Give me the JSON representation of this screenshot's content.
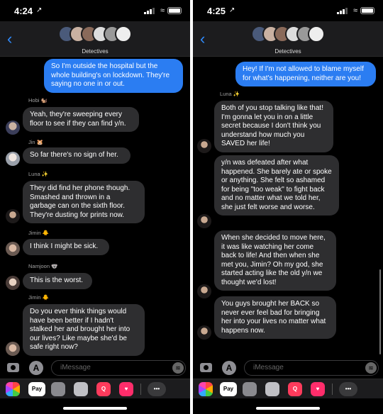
{
  "left": {
    "status": {
      "time": "4:24"
    },
    "header": {
      "group_name": "Detectives"
    },
    "messages": {
      "m1": "So I'm outside the hospital but the whole building's on lockdown. They're saying no one in or out.",
      "s2": "Hobi 🐿️",
      "m2": "Yeah, they're sweeping every floor to see if they can find y/n.",
      "s3": "Jin 🐹",
      "m3": "So far there's no sign of her.",
      "s4": "Luna ✨",
      "m4": "They did find her phone though. Smashed and thrown in a garbage can on the sixth floor. They're dusting for prints now.",
      "s5": "Jimin 🐥",
      "m5": "I think I might be sick.",
      "s6": "Namjoon 🐨",
      "m6": "This is the worst.",
      "s7": "Jimin 🐥",
      "m7": "Do you ever think things would have been better if I hadn't stalked her and brought her into our lives? Like maybe she'd be safe right now?"
    },
    "input": {
      "placeholder": "iMessage"
    }
  },
  "right": {
    "status": {
      "time": "4:25"
    },
    "header": {
      "group_name": "Detectives"
    },
    "messages": {
      "m1": "Hey! If I'm not allowed to blame myself for what's happening, neither are you!",
      "s2": "Luna ✨",
      "m2": "Both of you stop talking like that! I'm gonna let you in on a little secret because I don't think you understand how much you SAVED her life!",
      "m3": "y/n was defeated after what happened. She barely ate or spoke or anything. She felt so ashamed for being \"too weak\" to fight back and no matter what we told her, she just felt worse and worse.",
      "m4": "When she decided to move here, it was like watching her come back to life! And then when she met you, Jimin? Oh my god, she started acting like the old y/n we thought we'd lost!",
      "m5": "You guys brought her BACK so never ever feel bad for bringing her into your lives no matter what happens now."
    },
    "input": {
      "placeholder": "iMessage"
    }
  },
  "apps": {
    "pay": "Pay",
    "search": "Q",
    "heart": "♥",
    "more": "•••",
    "appstore": "A",
    "wave": "≋",
    "back": "‹",
    "wifi": "≈",
    "loc": "↗"
  },
  "colors": {
    "sent": "#2b7df2",
    "received": "#2e2e30",
    "accent": "#2f8cff"
  }
}
